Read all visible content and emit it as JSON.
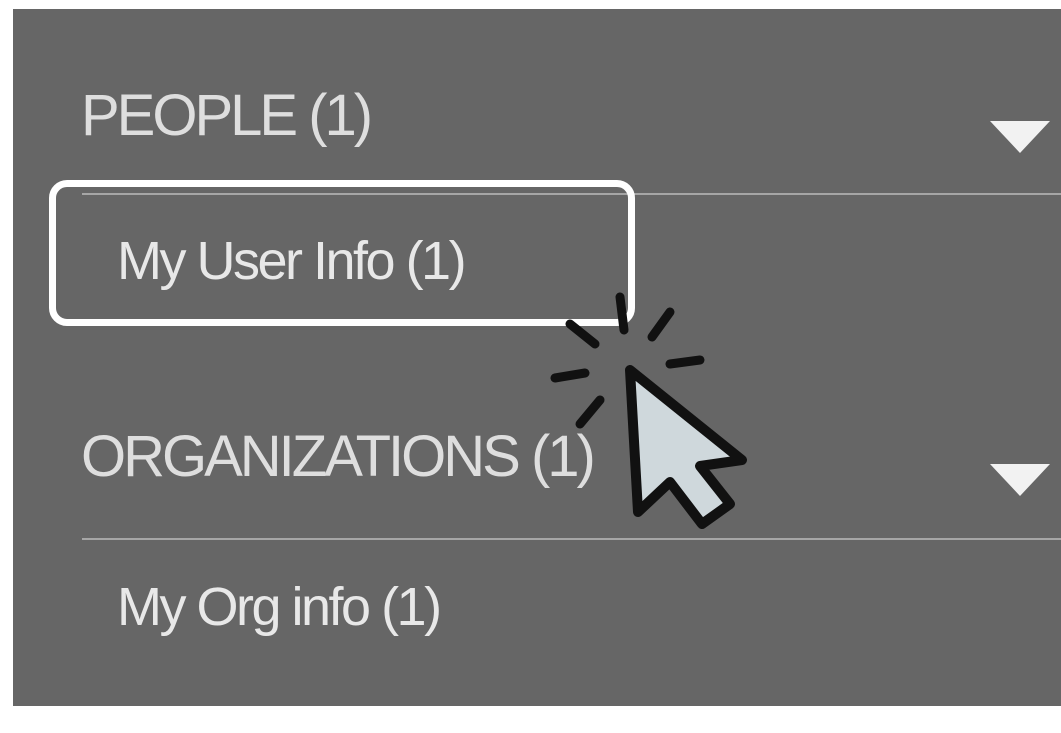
{
  "sections": [
    {
      "title": "PEOPLE (1)",
      "expand_icon": "caret-down-icon",
      "items": [
        {
          "label": "My User Info  (1)"
        }
      ]
    },
    {
      "title": "ORGANIZATIONS (1)",
      "expand_icon": "caret-down-icon",
      "items": [
        {
          "label": "My Org info  (1)"
        }
      ]
    }
  ],
  "cursor": {
    "icon": "mouse-pointer-click-icon"
  },
  "colors": {
    "panel_background": "#666666",
    "text": "#dedede",
    "divider": "#a6a6a6",
    "highlight": "#ffffff",
    "cursor_fill": "#cfd8dc"
  }
}
